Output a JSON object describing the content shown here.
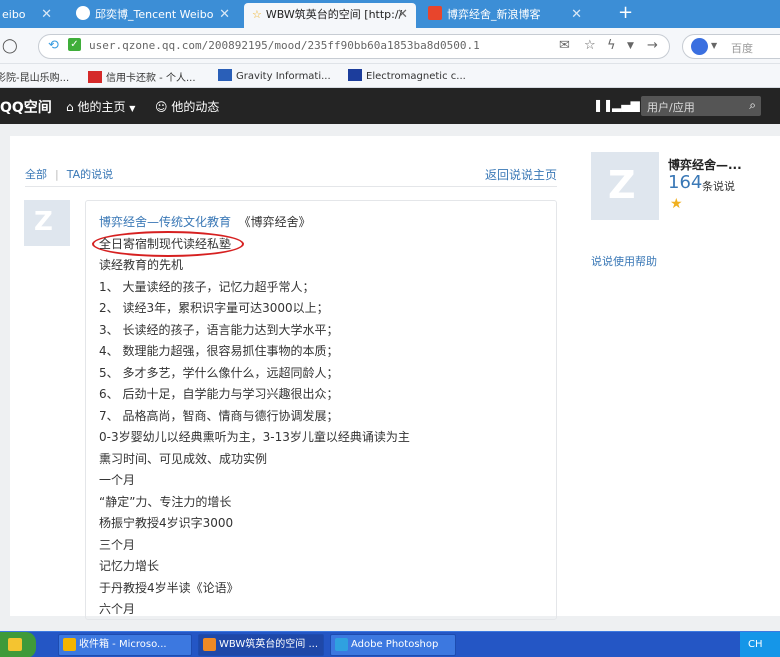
{
  "browser": {
    "tabs": [
      {
        "label": "eibo"
      },
      {
        "label": "邱奕博_Tencent Weibo"
      },
      {
        "label": "WBW筑英台的空间 [http://"
      },
      {
        "label": "博弈经舍_新浪博客"
      }
    ],
    "url": "user.qzone.qq.com/200892195/mood/235ff90bb60a1853ba8d0500.1",
    "search_placeholder": "百度",
    "bookmarks": [
      {
        "label": "影院-昆山乐购..."
      },
      {
        "label": "信用卡还款 - 个人..."
      },
      {
        "label": "Gravity Informati..."
      },
      {
        "label": "Electromagnetic c..."
      }
    ]
  },
  "qzone": {
    "logo": "QQ空间",
    "nav_home": "他的主页",
    "nav_feed": "他的动态",
    "user_app": "用户/应用"
  },
  "filters": {
    "all": "全部",
    "his_posts": "TA的说说"
  },
  "back_link": "返回说说主页",
  "post": {
    "title_link": "博弈经舍—传统文化教育",
    "title_tag": "《博弈经舍》",
    "lines": [
      "全日寄宿制现代读经私塾",
      "读经教育的先机",
      "1、 大量读经的孩子，记忆力超乎常人；",
      "2、 读经3年，累积识字量可达3000以上；",
      "3、 长读经的孩子，语言能力达到大学水平；",
      "4、 数理能力超强，很容易抓住事物的本质；",
      "5、 多才多艺，学什么像什么，远超同龄人；",
      "6、 后劲十足，自学能力与学习兴趣很出众；",
      "7、 品格高尚，智商、情商与德行协调发展；",
      "0-3岁婴幼儿以经典熏听为主，3-13岁儿童以经典诵读为主",
      "熏习时间、可见成效、成功实例",
      "一个月",
      "“静定”力、专注力的增长",
      "杨振宁教授4岁识字3000",
      "三个月",
      "记忆力增长",
      "于丹教授4岁半读《论语》",
      "六个月"
    ]
  },
  "sidebar": {
    "name": "博弈经舍—...",
    "count": "164",
    "count_unit": "条说说",
    "help": "说说使用帮助"
  },
  "taskbar": {
    "items": [
      {
        "label": "收件箱 - Microso..."
      },
      {
        "label": "WBW筑英台的空间 ..."
      },
      {
        "label": "Adobe Photoshop"
      }
    ],
    "lang": "CH"
  },
  "colors": {
    "accent": "#3a78b6",
    "highlight_circle": "#d62020",
    "header": "#242424"
  }
}
